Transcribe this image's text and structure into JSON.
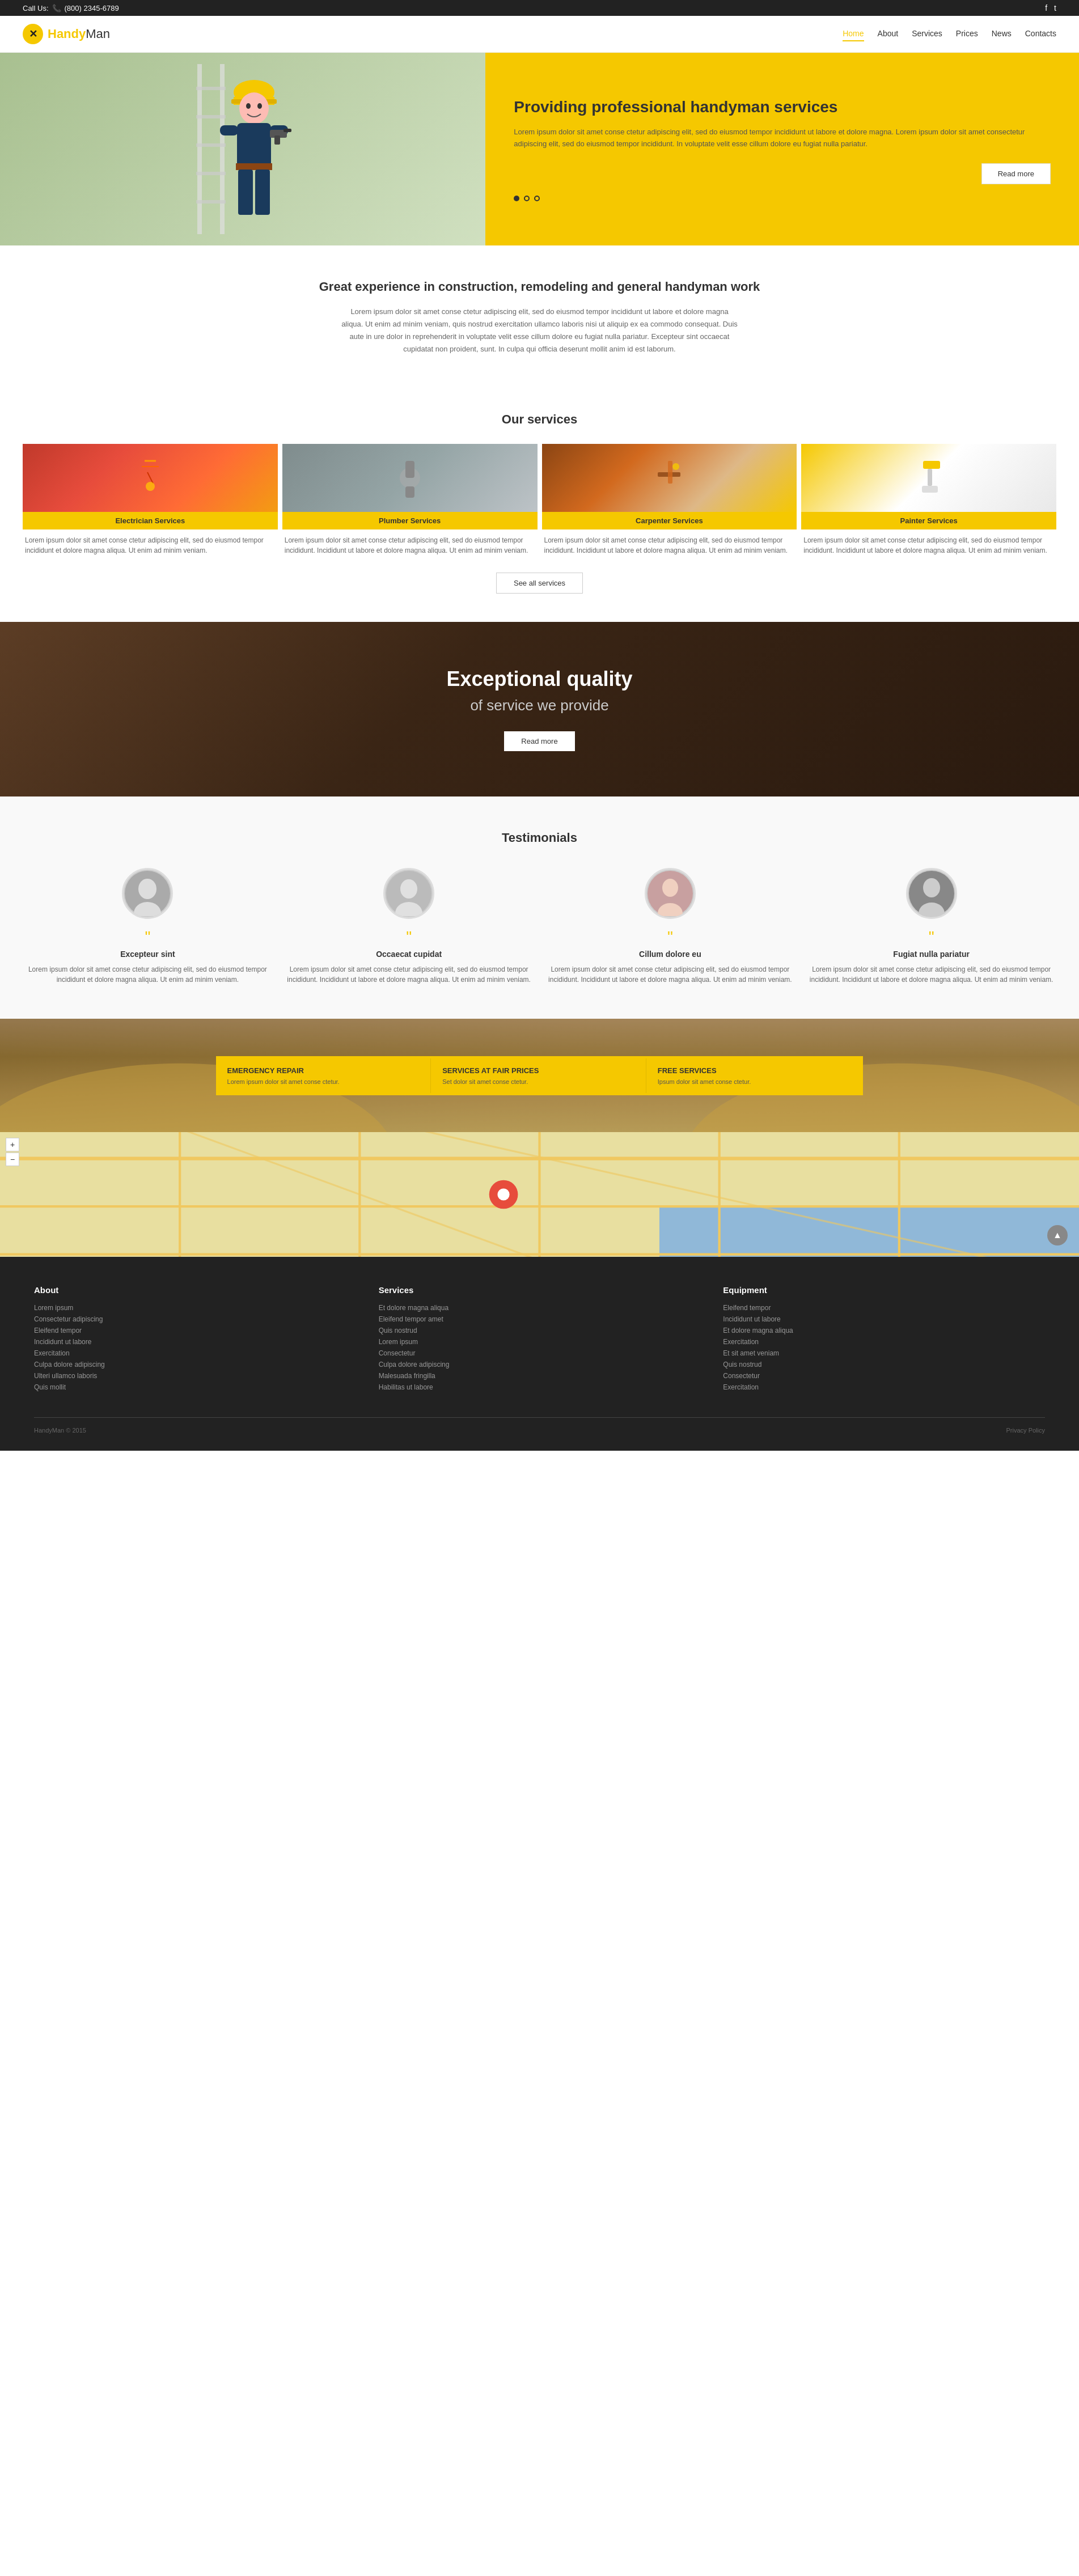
{
  "topbar": {
    "call_label": "Call Us:",
    "phone": "(800) 2345-6789",
    "social": [
      {
        "name": "facebook",
        "icon": "f",
        "url": "#"
      },
      {
        "name": "twitter",
        "icon": "t",
        "url": "#"
      }
    ]
  },
  "header": {
    "logo_text_1": "Handy",
    "logo_text_2": "Man",
    "logo_icon": "✕",
    "nav": [
      {
        "label": "Home",
        "active": true
      },
      {
        "label": "About",
        "active": false
      },
      {
        "label": "Services",
        "active": false
      },
      {
        "label": "Prices",
        "active": false
      },
      {
        "label": "News",
        "active": false
      },
      {
        "label": "Contacts",
        "active": false
      }
    ]
  },
  "hero": {
    "title": "Providing professional handyman services",
    "description": "Lorem ipsum dolor sit amet conse ctetur adipiscing elit, sed do eiusmod tempor incididunt ut labore et dolore magna. Lorem ipsum dolor sit amet consectetur adipiscing elit, sed do eiusmod tempor incididunt. In voluptate velit esse cillum dolore eu fugiat nulla pariatur.",
    "button_label": "Read more",
    "dots": [
      {
        "active": true
      },
      {
        "active": false
      },
      {
        "active": false
      }
    ]
  },
  "about": {
    "title": "Great experience in construction, remodeling and general handyman work",
    "description": "Lorem ipsum dolor sit amet conse ctetur adipiscing elit, sed do eiusmod tempor incididunt ut labore et dolore magna aliqua. Ut enim ad minim veniam, quis nostrud exercitation ullamco laboris nisi ut aliquip ex ea commodo consequat. Duis aute in ure dolor in reprehenderit in voluptate velit esse cillum dolore eu fugiat nulla pariatur. Excepteur sint occaecat cupidatat non proident, sunt. In culpa qui officia deserunt mollit anim id est laborum."
  },
  "services": {
    "title": "Our services",
    "items": [
      {
        "name": "Electrician Services",
        "type": "electrician",
        "description": "Lorem ipsum dolor sit amet conse ctetur adipiscing elit, sed do eiusmod tempor incididunt et dolore magna aliqua. Ut enim ad minim veniam."
      },
      {
        "name": "Plumber Services",
        "type": "plumber",
        "description": "Lorem ipsum dolor sit amet conse ctetur adipiscing elit, sed do eiusmod tempor incididunt. Incididunt ut labore et dolore magna aliqua. Ut enim ad minim veniam."
      },
      {
        "name": "Carpenter Services",
        "type": "carpenter",
        "description": "Lorem ipsum dolor sit amet conse ctetur adipiscing elit, sed do eiusmod tempor incididunt. Incididunt ut labore et dolore magna aliqua. Ut enim ad minim veniam."
      },
      {
        "name": "Painter Services",
        "type": "painter",
        "description": "Lorem ipsum dolor sit amet conse ctetur adipiscing elit, sed do eiusmod tempor incididunt. Incididunt ut labore et dolore magna aliqua. Ut enim ad minim veniam."
      }
    ],
    "see_all_label": "See all services"
  },
  "quality": {
    "title": "Exceptional quality",
    "subtitle": "of service we provide",
    "button_label": "Read more"
  },
  "testimonials": {
    "title": "Testimonials",
    "items": [
      {
        "name": "Excepteur sint",
        "avatar_letter": "👤",
        "description": "Lorem ipsum dolor sit amet conse ctetur adipiscing elit, sed do eiusmod tempor incididunt et dolore magna aliqua. Ut enim ad minim veniam."
      },
      {
        "name": "Occaecat cupidat",
        "avatar_letter": "👤",
        "description": "Lorem ipsum dolor sit amet conse ctetur adipiscing elit, sed do eiusmod tempor incididunt. Incididunt ut labore et dolore magna aliqua. Ut enim ad minim veniam."
      },
      {
        "name": "Cillum dolore eu",
        "avatar_letter": "👤",
        "description": "Lorem ipsum dolor sit amet conse ctetur adipiscing elit, sed do eiusmod tempor incididunt. Incididunt ut labore et dolore magna aliqua. Ut enim ad minim veniam."
      },
      {
        "name": "Fugiat nulla pariatur",
        "avatar_letter": "👤",
        "description": "Lorem ipsum dolor sit amet conse ctetur adipiscing elit, sed do eiusmod tempor incididunt. Incididunt ut labore et dolore magna aliqua. Ut enim ad minim veniam."
      }
    ]
  },
  "promo": {
    "cards": [
      {
        "title_bold": "EMERGENCY",
        "title_rest": " REPAIR",
        "description": "Lorem ipsum dolor sit amet conse ctetur."
      },
      {
        "title_bold": "SERVICES AT",
        "title_rest": " FAIR PRICES",
        "description": "Set dolor sit amet conse ctetur."
      },
      {
        "title_bold": "FREE",
        "title_rest": " SERVICES",
        "description": "Ipsum dolor sit amet conse ctetur."
      }
    ]
  },
  "footer": {
    "columns": [
      {
        "title": "About",
        "links": [
          "Lorem ipsum",
          "Consectetur adipiscing",
          "Eleifend tempor",
          "Incididunt ut labore",
          "Exercitation",
          "Culpa dolore adipiscing",
          "Ulteri ullamco laboris",
          "Quis mollit"
        ]
      },
      {
        "title": "Services",
        "links": [
          "Et dolore magna aliqua",
          "Eleifend tempor amet",
          "Quis nostrud",
          "Lorem ipsum",
          "Consectetur",
          "Culpa dolore adipiscing",
          "Malesuada fringilla",
          "Habilitas ut labore"
        ]
      },
      {
        "title": "Equipment",
        "links": [
          "Eleifend tempor",
          "Incididunt ut labore",
          "Et dolore magna aliqua",
          "Exercitation",
          "Et sit amet veniam",
          "Quis nostrud",
          "Consectetur",
          "Exercitation"
        ]
      }
    ],
    "copyright": "HandyMan © 2015",
    "privacy": "Privacy Policy"
  },
  "map": {
    "controls": [
      "+",
      "-"
    ],
    "scroll_top_icon": "▲"
  }
}
